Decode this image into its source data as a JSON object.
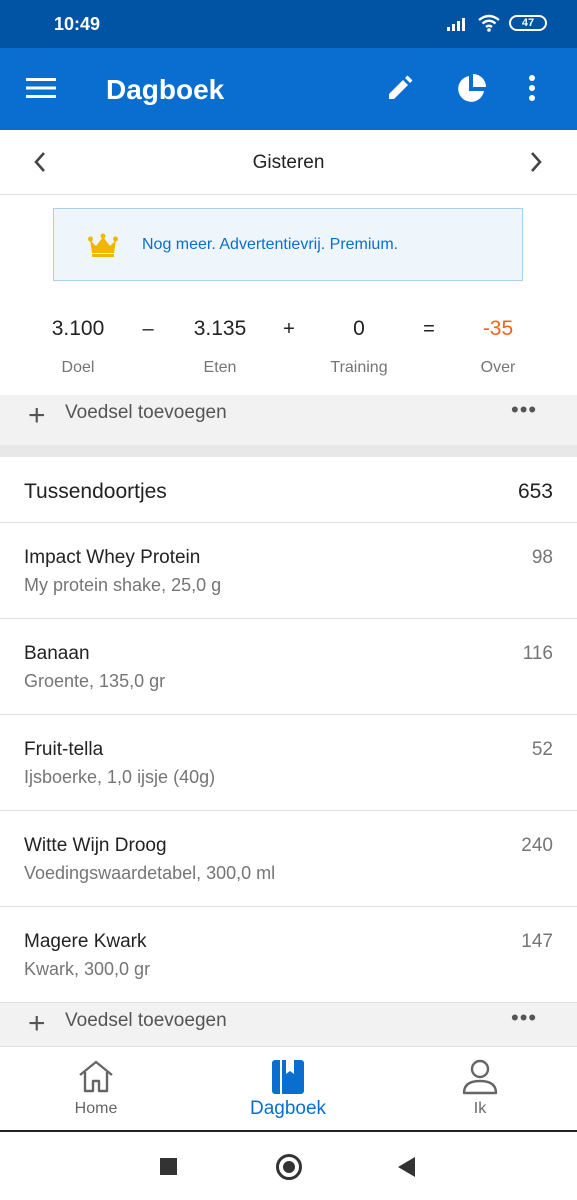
{
  "status_bar": {
    "time": "10:49",
    "battery": "47"
  },
  "app_bar": {
    "title": "Dagboek"
  },
  "date_nav": {
    "date": "Gisteren"
  },
  "premium_banner": {
    "text": "Nog meer. Advertentievrij. Premium."
  },
  "summary": {
    "goal_value": "3.100",
    "goal_label": "Doel",
    "minus": "–",
    "food_value": "3.135",
    "food_label": "Eten",
    "plus": "+",
    "exercise_value": "0",
    "exercise_label": "Training",
    "equals": "=",
    "remaining_value": "-35",
    "remaining_label": "Over"
  },
  "add_food_label": "Voedsel toevoegen",
  "add_food_label_2": "Voedsel toevoegen",
  "snacks": {
    "title": "Tussendoortjes",
    "calories": "653",
    "items": [
      {
        "name": "Impact Whey Protein",
        "desc": "My protein shake, 25,0 g",
        "cal": "98"
      },
      {
        "name": "Banaan",
        "desc": "Groente, 135,0 gr",
        "cal": "116"
      },
      {
        "name": "Fruit-tella",
        "desc": "Ijsboerke, 1,0 ijsje (40g)",
        "cal": "52"
      },
      {
        "name": "Witte Wijn Droog",
        "desc": "Voedingswaardetabel, 300,0 ml",
        "cal": "240"
      },
      {
        "name": "Magere Kwark",
        "desc": "Kwark, 300,0 gr",
        "cal": "147"
      }
    ]
  },
  "bottom_nav": {
    "home": "Home",
    "diary": "Dagboek",
    "me": "Ik"
  },
  "colors": {
    "primary": "#0A6ED1",
    "status": "#0153A4",
    "over": "#E8681E",
    "crown": "#F2B600"
  }
}
